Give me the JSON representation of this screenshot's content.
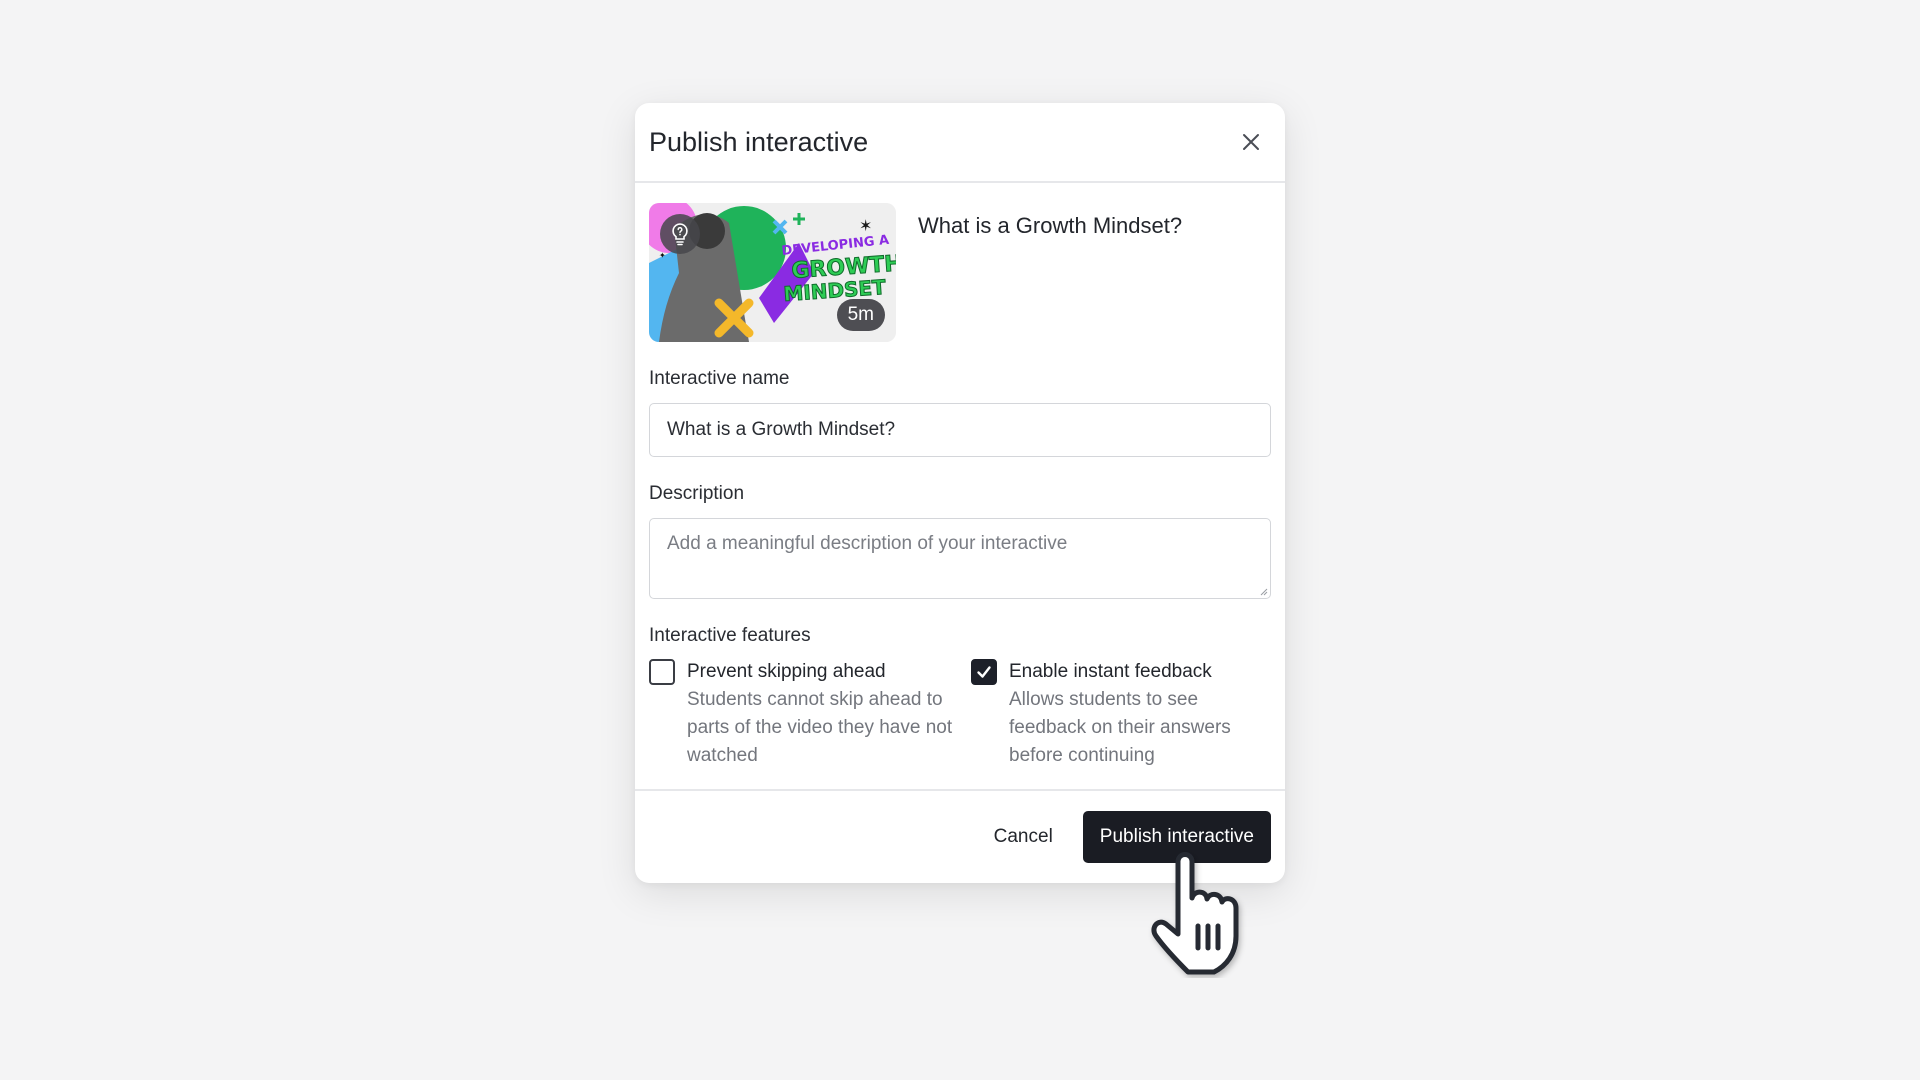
{
  "modal": {
    "title": "Publish interactive",
    "close_icon": "close-icon"
  },
  "video": {
    "title": "What is a Growth Mindset?",
    "thumbnail_text": "DEVELOPING A GROWTH MINDSET",
    "duration": "5m",
    "badge_icon": "lightbulb-question-icon"
  },
  "name_field": {
    "label": "Interactive name",
    "value": "What is a Growth Mindset?"
  },
  "description_field": {
    "label": "Description",
    "placeholder": "Add a meaningful description of your interactive"
  },
  "features": {
    "label": "Interactive features",
    "items": [
      {
        "title": "Prevent skipping ahead",
        "description": "Students cannot skip ahead to parts of the video they have not watched",
        "checked": false
      },
      {
        "title": "Enable instant feedback",
        "description": "Allows students to see feedback on their answers before continuing",
        "checked": true
      }
    ]
  },
  "footer": {
    "cancel_label": "Cancel",
    "publish_label": "Publish interactive"
  },
  "colors": {
    "primary": "#1a1c23",
    "background": "#f4f4f5"
  },
  "pointer_icon": "hand-pointer-icon"
}
